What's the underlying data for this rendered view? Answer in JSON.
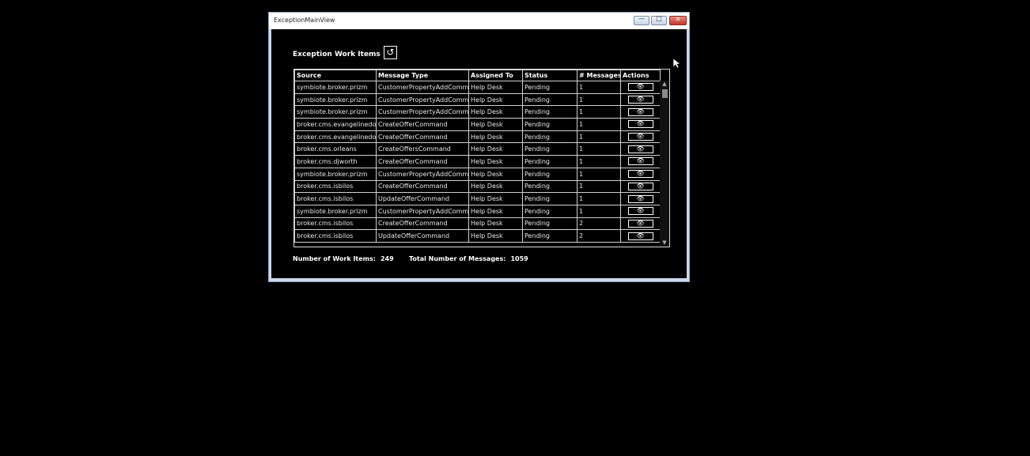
{
  "window": {
    "title": "ExceptionMainView",
    "controls": {
      "minimize": "—",
      "maximize": "□",
      "close": "✕"
    }
  },
  "header": {
    "title": "Exception Work Items",
    "refresh_icon": "↺"
  },
  "grid": {
    "columns": [
      "Source",
      "Message Type",
      "Assigned To",
      "Status",
      "# Messages",
      "Actions"
    ],
    "rows": [
      [
        "symbiote.broker.prizm",
        "CustomerPropertyAddComma",
        "Help Desk",
        "Pending",
        "1"
      ],
      [
        "symbiote.broker.prizm",
        "CustomerPropertyAddComma",
        "Help Desk",
        "Pending",
        "1"
      ],
      [
        "symbiote.broker.prizm",
        "CustomerPropertyAddComma",
        "Help Desk",
        "Pending",
        "1"
      ],
      [
        "broker.cms.evangelinedow",
        "CreateOfferCommand",
        "Help Desk",
        "Pending",
        "1"
      ],
      [
        "broker.cms.evangelinedow",
        "CreateOfferCommand",
        "Help Desk",
        "Pending",
        "1"
      ],
      [
        "broker.cms.orleans",
        "CreateOffersCommand",
        "Help Desk",
        "Pending",
        "1"
      ],
      [
        "broker.cms.djworth",
        "CreateOfferCommand",
        "Help Desk",
        "Pending",
        "1"
      ],
      [
        "symbiote.broker.prizm",
        "CustomerPropertyAddComma",
        "Help Desk",
        "Pending",
        "1"
      ],
      [
        "broker.cms.isbilos",
        "CreateOfferCommand",
        "Help Desk",
        "Pending",
        "1"
      ],
      [
        "broker.cms.isbilos",
        "UpdateOfferCommand",
        "Help Desk",
        "Pending",
        "1"
      ],
      [
        "symbiote.broker.prizm",
        "CustomerPropertyAddComma",
        "Help Desk",
        "Pending",
        "1"
      ],
      [
        "broker.cms.isbilos",
        "CreateOfferCommand",
        "Help Desk",
        "Pending",
        "2"
      ],
      [
        "broker.cms.isbilos",
        "UpdateOfferCommand",
        "Help Desk",
        "Pending",
        "2"
      ]
    ],
    "action_icon": "👁",
    "scroll": {
      "up": "▲",
      "down": "▼"
    }
  },
  "footer": {
    "work_items_label": "Number of Work Items:",
    "work_items_value": "249",
    "messages_label": "Total Number of Messages:",
    "messages_value": "1059"
  },
  "colors": {
    "background": "#000000",
    "window_frame": "#c9d8ec",
    "close_button": "#c0392b"
  }
}
